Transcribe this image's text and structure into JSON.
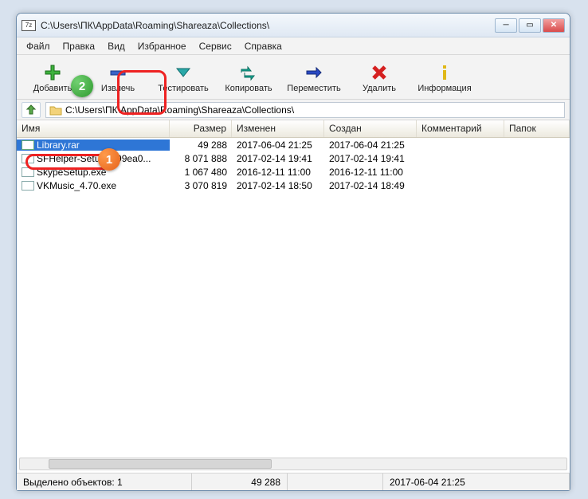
{
  "title": "C:\\Users\\ПК\\AppData\\Roaming\\Shareaza\\Collections\\",
  "app_icon": "7z",
  "menu": [
    "Файл",
    "Правка",
    "Вид",
    "Избранное",
    "Сервис",
    "Справка"
  ],
  "toolbar": [
    {
      "label": "Добавить",
      "icon": "plus"
    },
    {
      "label": "Извлечь",
      "icon": "minus"
    },
    {
      "label": "Тестировать",
      "icon": "check"
    },
    {
      "label": "Копировать",
      "icon": "copy"
    },
    {
      "label": "Переместить",
      "icon": "move"
    },
    {
      "label": "Удалить",
      "icon": "delete"
    },
    {
      "label": "Информация",
      "icon": "info"
    }
  ],
  "path": "C:\\Users\\ПК\\AppData\\Roaming\\Shareaza\\Collections\\",
  "columns": [
    "Имя",
    "Размер",
    "Изменен",
    "Создан",
    "Комментарий",
    "Папок"
  ],
  "files": [
    {
      "name": "Library.rar",
      "size": "49 288",
      "modified": "2017-06-04 21:25",
      "created": "2017-06-04 21:25",
      "selected": true,
      "type": "rar"
    },
    {
      "name": "SFHelper-Setup-[199ea0...",
      "size": "8 071 888",
      "modified": "2017-02-14 19:41",
      "created": "2017-02-14 19:41",
      "selected": false,
      "type": "exe"
    },
    {
      "name": "SkypeSetup.exe",
      "size": "1 067 480",
      "modified": "2016-12-11 11:00",
      "created": "2016-12-11 11:00",
      "selected": false,
      "type": "exe"
    },
    {
      "name": "VKMusic_4.70.exe",
      "size": "3 070 819",
      "modified": "2017-02-14 18:50",
      "created": "2017-02-14 18:49",
      "selected": false,
      "type": "exe"
    }
  ],
  "status": {
    "selection": "Выделено объектов: 1",
    "size": "49 288",
    "date": "2017-06-04 21:25"
  },
  "annotations": {
    "badge1": "1",
    "badge2": "2"
  }
}
